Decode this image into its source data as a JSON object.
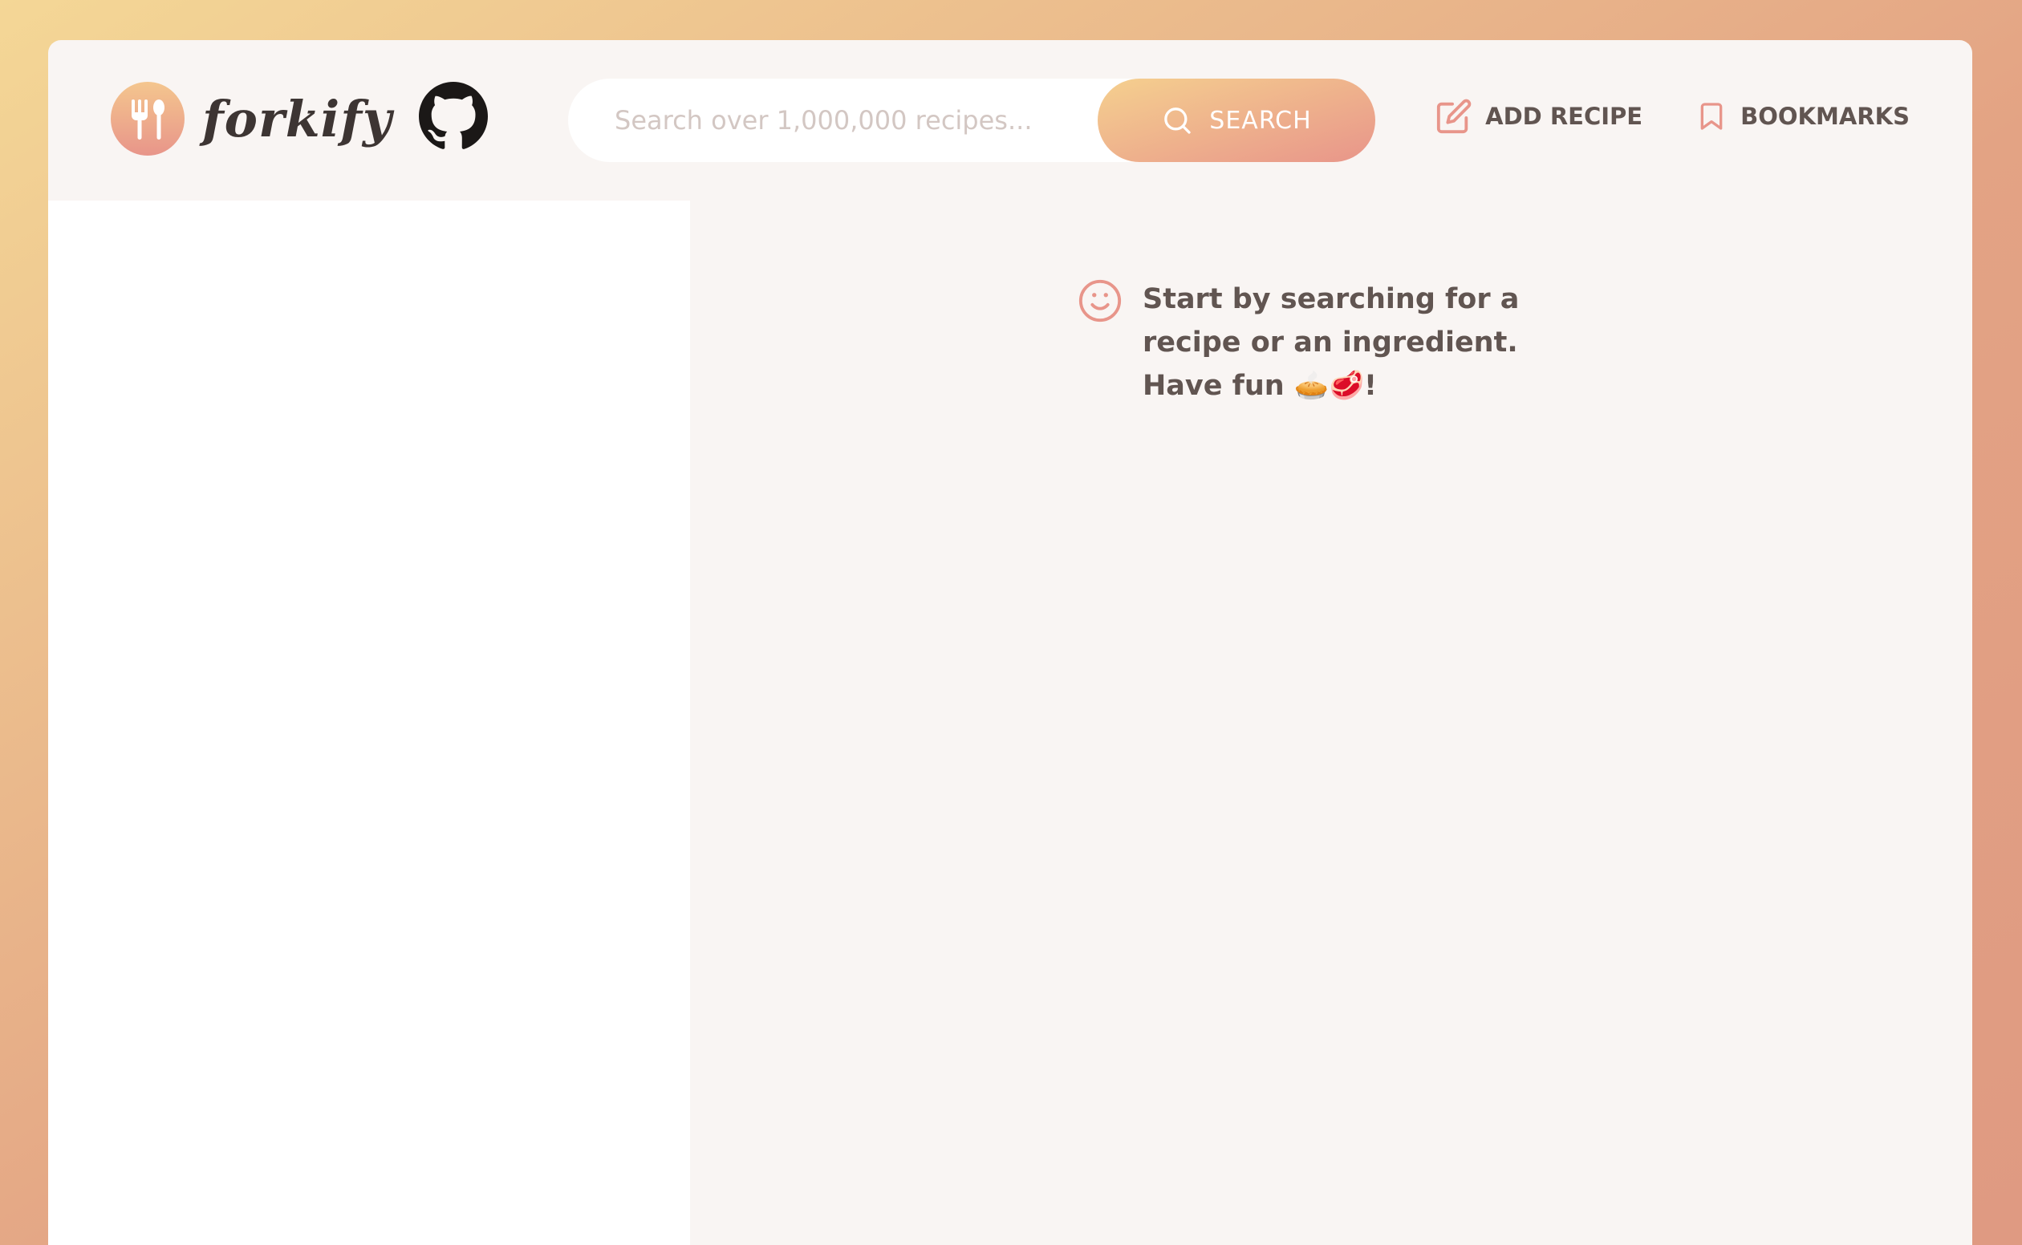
{
  "header": {
    "logo_text": "forkify",
    "search": {
      "placeholder": "Search over 1,000,000 recipes...",
      "value": "",
      "button_label": "SEARCH"
    },
    "nav": {
      "add_recipe_label": "ADD RECIPE",
      "bookmarks_label": "BOOKMARKS"
    }
  },
  "recipe_panel": {
    "message": "Start by searching for a recipe or an ingredient. Have fun 🥧🥩!"
  },
  "colors": {
    "accent_start": "#f4d796",
    "accent_end": "#e8958a",
    "text": "#615551",
    "panel_bg": "#f9f5f3"
  },
  "icons": [
    "fork-spoon-icon",
    "github-icon",
    "search-icon",
    "edit-icon",
    "bookmark-icon",
    "smile-icon"
  ]
}
